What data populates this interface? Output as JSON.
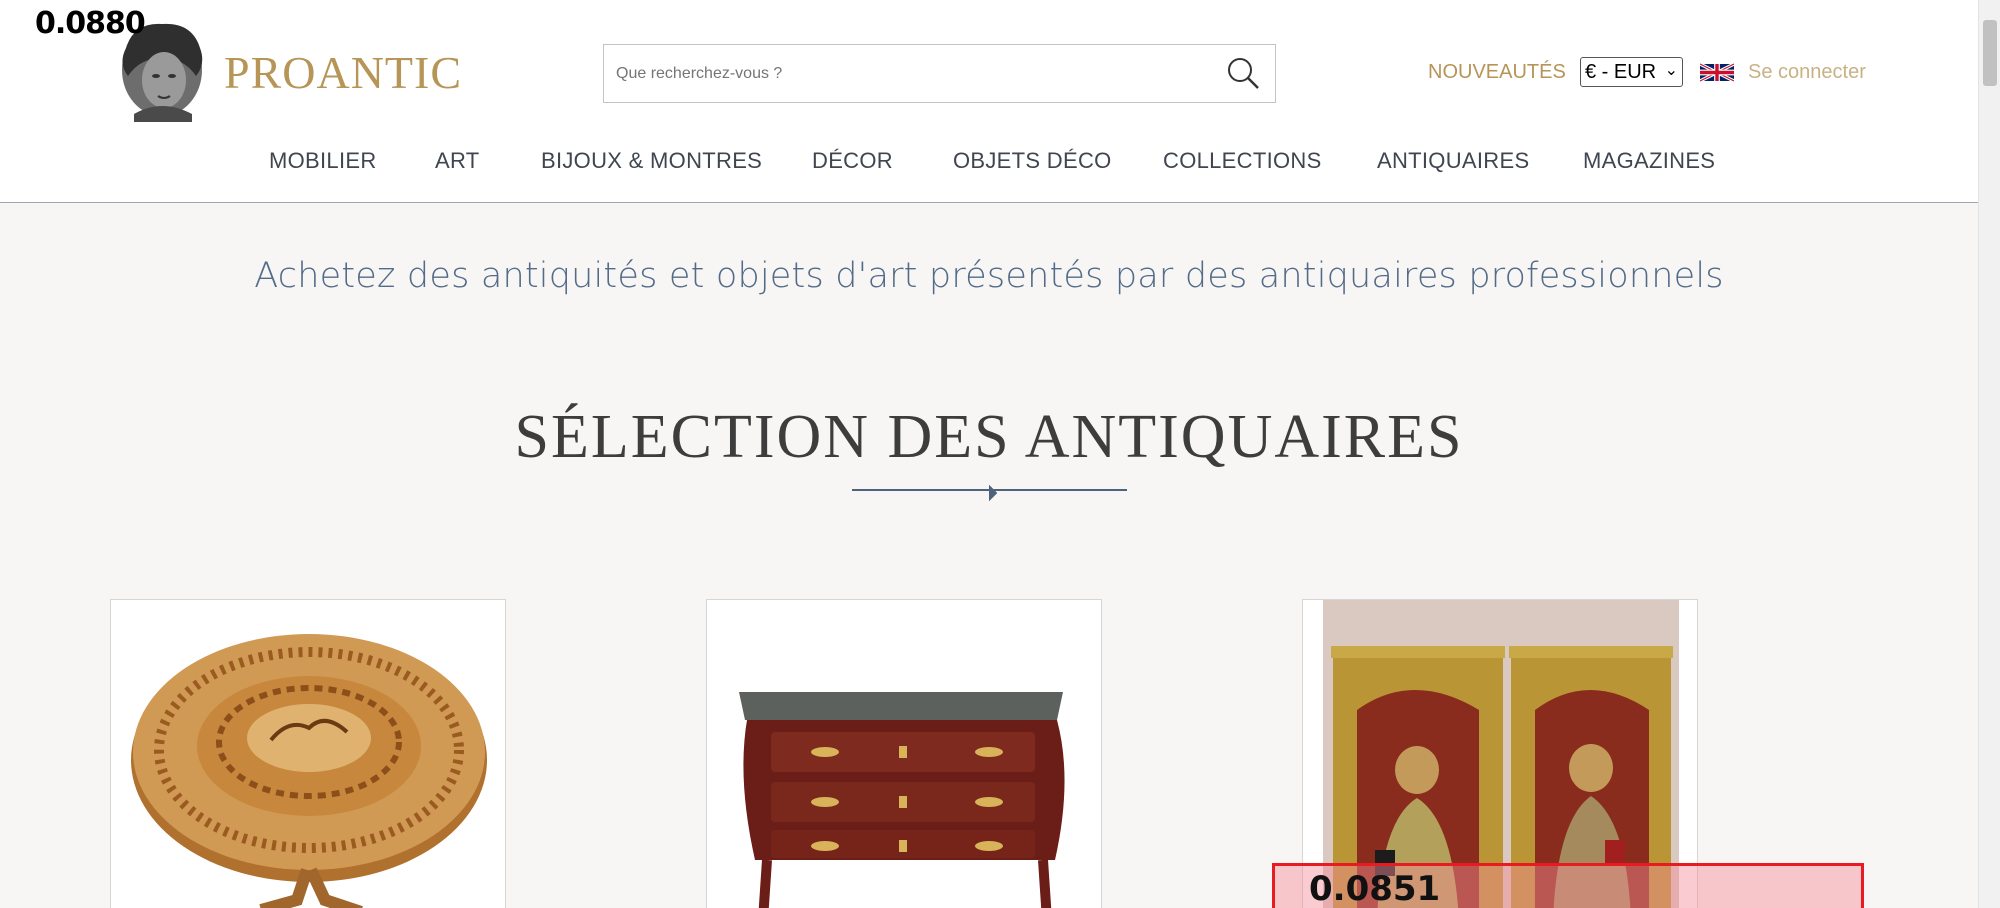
{
  "overlay": {
    "score_top": "0.0880",
    "score_bottom": "0.0851"
  },
  "header": {
    "brand": "PROANTIC",
    "search_placeholder": "Que recherchez-vous ?",
    "nouveautes": "NOUVEAUTÉS",
    "currency": "€ - EUR",
    "signin": "Se connecter",
    "icons": {
      "search": "search-icon",
      "flag": "uk-flag-icon",
      "logo": "bust-logo-icon"
    }
  },
  "nav": {
    "items": [
      "MOBILIER",
      "ART",
      "BIJOUX & MONTRES",
      "DÉCOR",
      "OBJETS DÉCO",
      "COLLECTIONS",
      "ANTIQUAIRES",
      "MAGAZINES"
    ]
  },
  "main": {
    "tagline": "Achetez des antiquités et objets d'art présentés par des antiquaires professionnels",
    "section_title": "SÉLECTION DES ANTIQUAIRES"
  },
  "colors": {
    "gold": "#b69557",
    "navy": "#536b88",
    "highlight": "#e81b23"
  }
}
